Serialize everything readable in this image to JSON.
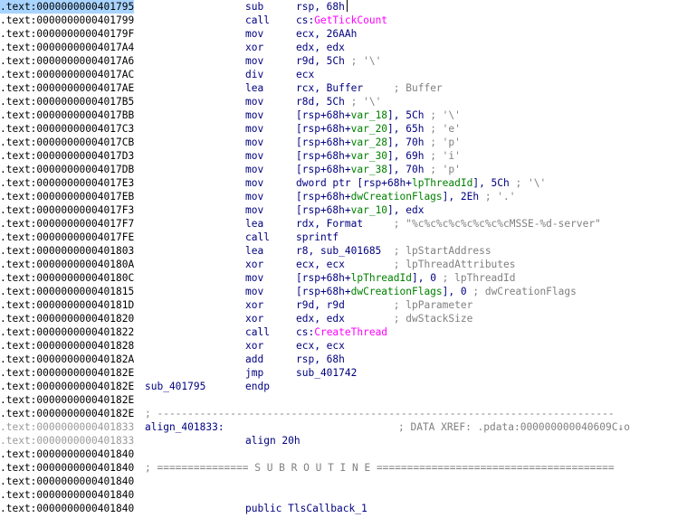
{
  "rows": [
    {
      "addr": ".text:0000000000401795",
      "mn": "sub",
      "ops": "rsp, 68h"
    },
    {
      "addr": ".text:0000000000401799",
      "mn": "call",
      "ops_prefix": "cs:",
      "ops_ext": "GetTickCount"
    },
    {
      "addr": ".text:000000000040179F",
      "mn": "mov",
      "ops": "ecx, 26AAh"
    },
    {
      "addr": ".text:00000000004017A4",
      "mn": "xor",
      "ops": "edx, edx"
    },
    {
      "addr": ".text:00000000004017A6",
      "mn": "mov",
      "ops": "r9d, 5Ch",
      "cmt": " ; '\\'"
    },
    {
      "addr": ".text:00000000004017AC",
      "mn": "div",
      "ops": "ecx"
    },
    {
      "addr": ".text:00000000004017AE",
      "mn": "lea",
      "ops": "rcx, Buffer     ",
      "cmt": "; Buffer"
    },
    {
      "addr": ".text:00000000004017B5",
      "mn": "mov",
      "ops": "r8d, 5Ch",
      "cmt": " ; '\\'"
    },
    {
      "addr": ".text:00000000004017BB",
      "mn": "mov",
      "ops_pre": "[rsp+68h+",
      "ops_var": "var_18",
      "ops_post": "], 5Ch",
      "cmt": " ; '\\'"
    },
    {
      "addr": ".text:00000000004017C3",
      "mn": "mov",
      "ops_pre": "[rsp+68h+",
      "ops_var": "var_20",
      "ops_post": "], 65h",
      "cmt": " ; 'e'"
    },
    {
      "addr": ".text:00000000004017CB",
      "mn": "mov",
      "ops_pre": "[rsp+68h+",
      "ops_var": "var_28",
      "ops_post": "], 70h",
      "cmt": " ; 'p'"
    },
    {
      "addr": ".text:00000000004017D3",
      "mn": "mov",
      "ops_pre": "[rsp+68h+",
      "ops_var": "var_30",
      "ops_post": "], 69h",
      "cmt": " ; 'i'"
    },
    {
      "addr": ".text:00000000004017DB",
      "mn": "mov",
      "ops_pre": "[rsp+68h+",
      "ops_var": "var_38",
      "ops_post": "], 70h",
      "cmt": " ; 'p'"
    },
    {
      "addr": ".text:00000000004017E3",
      "mn": "mov",
      "ops_pre": "dword ptr [rsp+68h+",
      "ops_var": "lpThreadId",
      "ops_post": "], 5Ch",
      "cmt": " ; '\\'"
    },
    {
      "addr": ".text:00000000004017EB",
      "mn": "mov",
      "ops_pre": "[rsp+68h+",
      "ops_var": "dwCreationFlags",
      "ops_post": "], 2Eh",
      "cmt": " ; '.'"
    },
    {
      "addr": ".text:00000000004017F3",
      "mn": "mov",
      "ops_pre": "[rsp+68h+",
      "ops_var": "var_10",
      "ops_post": "], edx"
    },
    {
      "addr": ".text:00000000004017F7",
      "mn": "lea",
      "ops": "rdx, Format     ",
      "cmt": "; \"%c%c%c%c%c%c%c%cMSSE-%d-server\""
    },
    {
      "addr": ".text:00000000004017FE",
      "mn": "call",
      "ops": "sprintf"
    },
    {
      "addr": ".text:0000000000401803",
      "mn": "lea",
      "ops": "r8, sub_401685  ",
      "cmt": "; lpStartAddress"
    },
    {
      "addr": ".text:000000000040180A",
      "mn": "xor",
      "ops": "ecx, ecx        ",
      "cmt": "; lpThreadAttributes"
    },
    {
      "addr": ".text:000000000040180C",
      "mn": "mov",
      "ops_pre": "[rsp+68h+",
      "ops_var": "lpThreadId",
      "ops_post": "], 0",
      "cmt": " ; lpThreadId"
    },
    {
      "addr": ".text:0000000000401815",
      "mn": "mov",
      "ops_pre": "[rsp+68h+",
      "ops_var": "dwCreationFlags",
      "ops_post": "], 0",
      "cmt": " ; dwCreationFlags"
    },
    {
      "addr": ".text:000000000040181D",
      "mn": "xor",
      "ops": "r9d, r9d        ",
      "cmt": "; lpParameter"
    },
    {
      "addr": ".text:0000000000401820",
      "mn": "xor",
      "ops": "edx, edx        ",
      "cmt": "; dwStackSize"
    },
    {
      "addr": ".text:0000000000401822",
      "mn": "call",
      "ops_prefix": "cs:",
      "ops_ext": "CreateThread"
    },
    {
      "addr": ".text:0000000000401828",
      "mn": "xor",
      "ops": "ecx, ecx"
    },
    {
      "addr": ".text:000000000040182A",
      "mn": "add",
      "ops": "rsp, 68h"
    },
    {
      "addr": ".text:000000000040182E",
      "mn": "jmp",
      "ops": "sub_401742"
    }
  ],
  "endp": {
    "addr": ".text:000000000040182E",
    "label": "sub_401795",
    "mn": "endp"
  },
  "blank1": {
    "addr": ".text:000000000040182E"
  },
  "sep1": {
    "addr": ".text:000000000040182E",
    "text": "; ---------------------------------------------------------------------------"
  },
  "align_label": {
    "addr": ".text:0000000000401833",
    "label": "align_401833:",
    "xref": "; DATA XREF: .pdata:000000000040609C↓o"
  },
  "align_line": {
    "addr": ".text:0000000000401833",
    "mn": "align 20h"
  },
  "blank2": {
    "addr": ".text:0000000000401840"
  },
  "sep2": {
    "addr": ".text:0000000000401840",
    "text": "; =============== S U B R O U T I N E ======================================="
  },
  "blank3": {
    "addr": ".text:0000000000401840"
  },
  "blank4": {
    "addr": ".text:0000000000401840"
  },
  "public_line": {
    "addr": ".text:0000000000401840",
    "mn": "public TlsCallback_1"
  }
}
